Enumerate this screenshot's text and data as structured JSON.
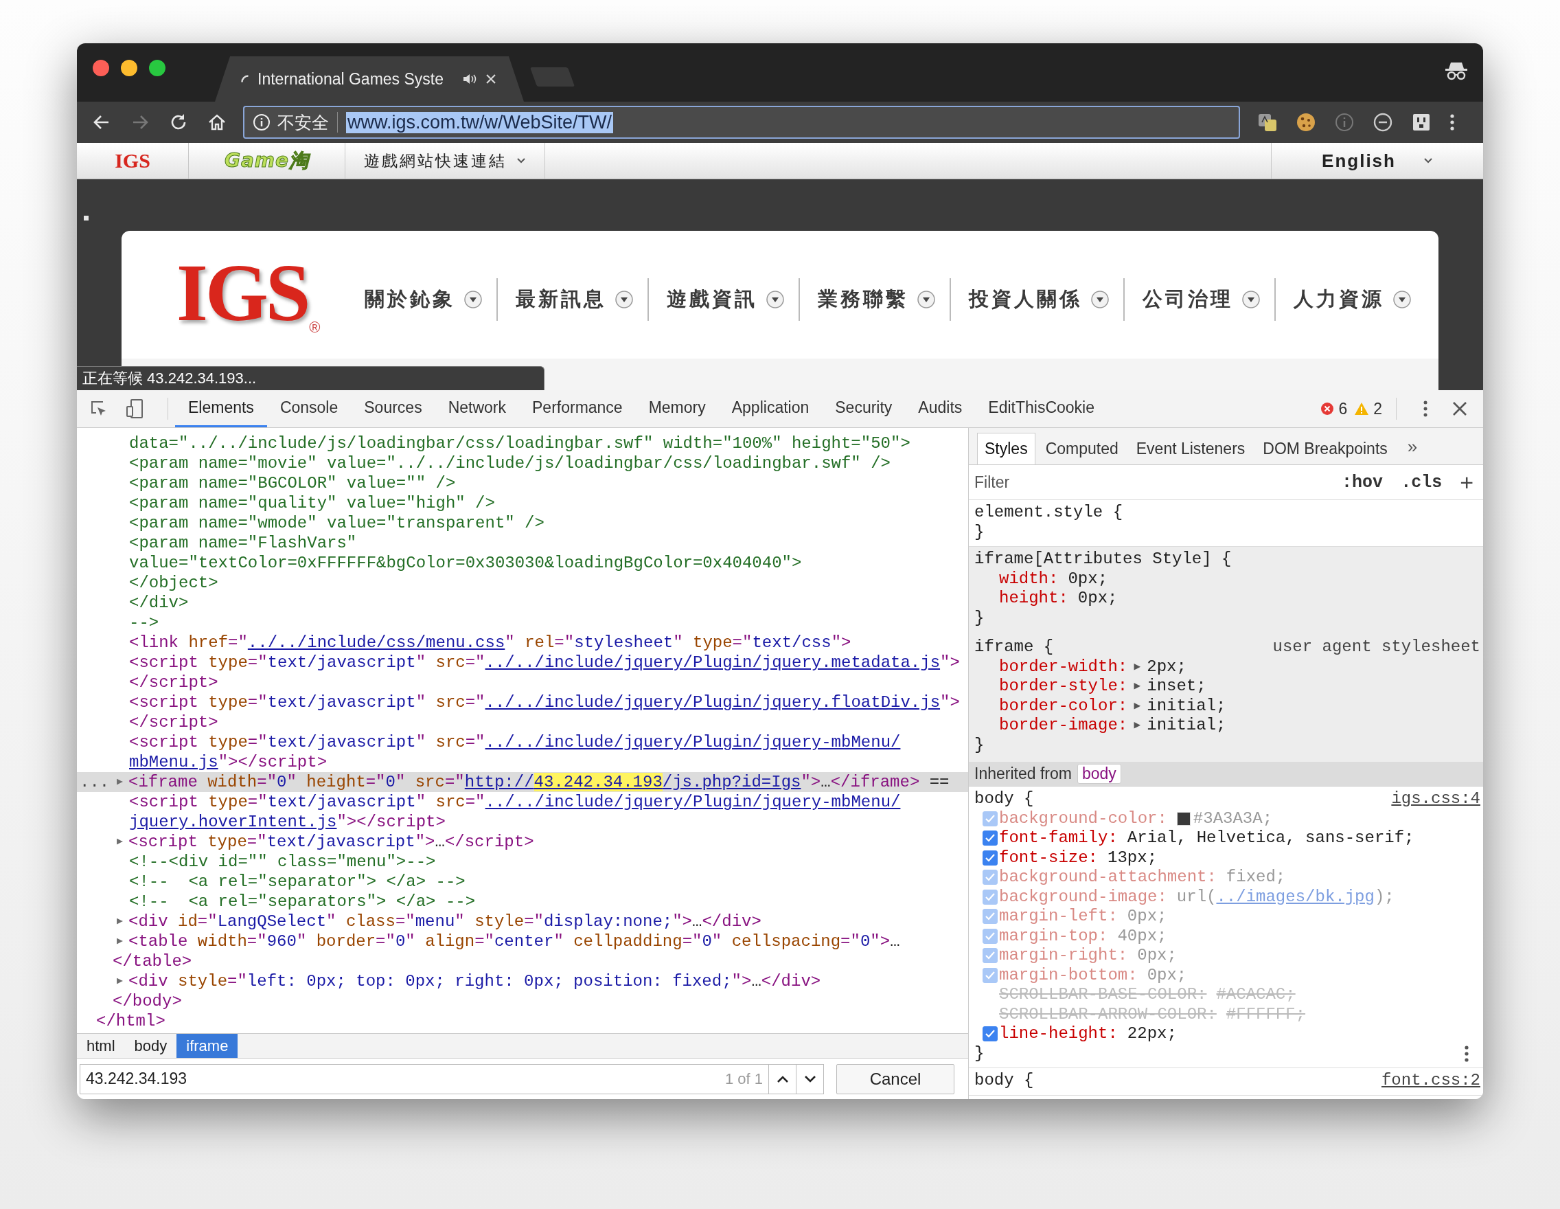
{
  "browser": {
    "tab": {
      "title": "International Games Syste"
    },
    "address": {
      "security": "不安全",
      "url": "www.igs.com.tw/w/WebSite/TW/",
      "selected": true
    }
  },
  "site_bar": {
    "logo": "IGS",
    "game_logo": "Game淘",
    "quick_links": "遊戲網站快速連結",
    "language": "English"
  },
  "site_header": {
    "logo": "IGS",
    "logo_mark": "®",
    "nav": [
      {
        "label": "關於鈊象"
      },
      {
        "label": "最新訊息"
      },
      {
        "label": "遊戲資訊"
      },
      {
        "label": "業務聯繫"
      },
      {
        "label": "投資人關係"
      },
      {
        "label": "公司治理"
      },
      {
        "label": "人力資源"
      }
    ]
  },
  "status_bubble": "正在等候 43.242.34.193...",
  "devtools": {
    "tabs": [
      {
        "label": "Elements",
        "selected": true
      },
      {
        "label": "Console",
        "selected": false
      },
      {
        "label": "Sources",
        "selected": false
      },
      {
        "label": "Network",
        "selected": false
      },
      {
        "label": "Performance",
        "selected": false
      },
      {
        "label": "Memory",
        "selected": false
      },
      {
        "label": "Application",
        "selected": false
      },
      {
        "label": "Security",
        "selected": false
      },
      {
        "label": "Audits",
        "selected": false
      },
      {
        "label": "EditThisCookie",
        "selected": false
      }
    ],
    "errors": "6",
    "warnings": "2",
    "dom_tree": [
      {
        "kind": "group",
        "children": [
          {
            "kind": "group",
            "children": [
              {
                "kind": "node",
                "selected": false,
                "tokens": [
                  {
                    "kind": "comment",
                    "text": "data=\"../../include/js/loadingbar/css/loadingbar.swf\" width=\"100%\" height=\"50\">"
                  }
                ]
              },
              {
                "kind": "node",
                "selected": false,
                "tokens": [
                  {
                    "kind": "comment",
                    "text": "<param name=\"movie\" value=\"../../include/js/loadingbar/css/loadingbar.swf\" />"
                  }
                ]
              },
              {
                "kind": "node",
                "selected": false,
                "tokens": [
                  {
                    "kind": "comment",
                    "text": "<param name=\"BGCOLOR\" value=\"\" />"
                  }
                ]
              },
              {
                "kind": "node",
                "selected": false,
                "tokens": [
                  {
                    "kind": "comment",
                    "text": "<param name=\"quality\" value=\"high\" />"
                  }
                ]
              },
              {
                "kind": "node",
                "selected": false,
                "tokens": [
                  {
                    "kind": "comment",
                    "text": "<param name=\"wmode\" value=\"transparent\" />"
                  }
                ]
              },
              {
                "kind": "node",
                "selected": false,
                "tokens": [
                  {
                    "kind": "comment",
                    "text": "<param name=\"FlashVars\""
                  }
                ]
              },
              {
                "kind": "node",
                "selected": false,
                "tokens": [
                  {
                    "kind": "comment",
                    "text": "value=\"textColor=0xFFFFFF&bgColor=0x303030&loadingBgColor=0x404040\">"
                  }
                ]
              },
              {
                "kind": "node",
                "selected": false,
                "tokens": [
                  {
                    "kind": "comment",
                    "text": "</object>"
                  }
                ]
              },
              {
                "kind": "node",
                "selected": false,
                "tokens": [
                  {
                    "kind": "comment",
                    "text": "</div>"
                  }
                ]
              },
              {
                "kind": "node",
                "selected": false,
                "tokens": [
                  {
                    "kind": "comment",
                    "text": "-->"
                  }
                ]
              },
              {
                "kind": "node",
                "selected": false,
                "tokens": [
                  {
                    "kind": "tag",
                    "text": "<link "
                  },
                  {
                    "kind": "attr",
                    "text": "href"
                  },
                  {
                    "kind": "tag",
                    "text": "=\""
                  },
                  {
                    "kind": "link",
                    "text": "../../include/css/menu.css"
                  },
                  {
                    "kind": "tag",
                    "text": "\" "
                  },
                  {
                    "kind": "attr",
                    "text": "rel"
                  },
                  {
                    "kind": "tag",
                    "text": "=\""
                  },
                  {
                    "kind": "value",
                    "text": "stylesheet"
                  },
                  {
                    "kind": "tag",
                    "text": "\" "
                  },
                  {
                    "kind": "attr",
                    "text": "type"
                  },
                  {
                    "kind": "tag",
                    "text": "=\""
                  },
                  {
                    "kind": "value",
                    "text": "text/css"
                  },
                  {
                    "kind": "tag",
                    "text": "\">"
                  }
                ]
              },
              {
                "kind": "node",
                "selected": false,
                "tokens": [
                  {
                    "kind": "tag",
                    "text": "<script "
                  },
                  {
                    "kind": "attr",
                    "text": "type"
                  },
                  {
                    "kind": "tag",
                    "text": "=\""
                  },
                  {
                    "kind": "value",
                    "text": "text/javascript"
                  },
                  {
                    "kind": "tag",
                    "text": "\" "
                  },
                  {
                    "kind": "attr",
                    "text": "src"
                  },
                  {
                    "kind": "tag",
                    "text": "=\""
                  },
                  {
                    "kind": "link",
                    "text": "../../include/jquery/Plugin/jquery.metadata.js"
                  },
                  {
                    "kind": "tag",
                    "text": "\">"
                  }
                ]
              },
              {
                "kind": "node",
                "selected": false,
                "tokens": [
                  {
                    "kind": "tag",
                    "text": "</script>"
                  }
                ]
              },
              {
                "kind": "node",
                "selected": false,
                "tokens": [
                  {
                    "kind": "tag",
                    "text": "<script "
                  },
                  {
                    "kind": "attr",
                    "text": "type"
                  },
                  {
                    "kind": "tag",
                    "text": "=\""
                  },
                  {
                    "kind": "value",
                    "text": "text/javascript"
                  },
                  {
                    "kind": "tag",
                    "text": "\" "
                  },
                  {
                    "kind": "attr",
                    "text": "src"
                  },
                  {
                    "kind": "tag",
                    "text": "=\""
                  },
                  {
                    "kind": "link",
                    "text": "../../include/jquery/Plugin/jquery.floatDiv.js"
                  },
                  {
                    "kind": "tag",
                    "text": "\">"
                  }
                ]
              },
              {
                "kind": "node",
                "selected": false,
                "tokens": [
                  {
                    "kind": "tag",
                    "text": "</script>"
                  }
                ]
              },
              {
                "kind": "node",
                "selected": false,
                "tokens": [
                  {
                    "kind": "tag",
                    "text": "<script "
                  },
                  {
                    "kind": "attr",
                    "text": "type"
                  },
                  {
                    "kind": "tag",
                    "text": "=\""
                  },
                  {
                    "kind": "value",
                    "text": "text/javascript"
                  },
                  {
                    "kind": "tag",
                    "text": "\" "
                  },
                  {
                    "kind": "attr",
                    "text": "src"
                  },
                  {
                    "kind": "tag",
                    "text": "=\""
                  },
                  {
                    "kind": "link",
                    "text": "../../include/jquery/Plugin/jquery-mbMenu/"
                  }
                ]
              },
              {
                "kind": "node",
                "selected": false,
                "tokens": [
                  {
                    "kind": "link",
                    "text": "mbMenu.js"
                  },
                  {
                    "kind": "tag",
                    "text": "\"></script>"
                  }
                ]
              },
              {
                "kind": "node",
                "selected": true,
                "gutter": "...",
                "tokens": [
                  {
                    "kind": "toggle",
                    "text": "▶"
                  },
                  {
                    "kind": "tag",
                    "text": "<iframe "
                  },
                  {
                    "kind": "attr",
                    "text": "width"
                  },
                  {
                    "kind": "tag",
                    "text": "=\""
                  },
                  {
                    "kind": "value",
                    "text": "0"
                  },
                  {
                    "kind": "tag",
                    "text": "\" "
                  },
                  {
                    "kind": "attr",
                    "text": "height"
                  },
                  {
                    "kind": "tag",
                    "text": "=\""
                  },
                  {
                    "kind": "value",
                    "text": "0"
                  },
                  {
                    "kind": "tag",
                    "text": "\" "
                  },
                  {
                    "kind": "attr",
                    "text": "src"
                  },
                  {
                    "kind": "tag",
                    "text": "=\""
                  },
                  {
                    "kind": "link",
                    "text": "http://"
                  },
                  {
                    "kind": "match",
                    "text": "43.242.34.193"
                  },
                  {
                    "kind": "link",
                    "text": "/js.php?id=Igs"
                  },
                  {
                    "kind": "tag",
                    "text": "\">"
                  },
                  {
                    "kind": "plain",
                    "text": "…"
                  },
                  {
                    "kind": "tag",
                    "text": "</iframe>"
                  },
                  {
                    "kind": "plain",
                    "text": " =="
                  }
                ]
              },
              {
                "kind": "node",
                "selected": false,
                "tokens": [
                  {
                    "kind": "tag",
                    "text": "<script "
                  },
                  {
                    "kind": "attr",
                    "text": "type"
                  },
                  {
                    "kind": "tag",
                    "text": "=\""
                  },
                  {
                    "kind": "value",
                    "text": "text/javascript"
                  },
                  {
                    "kind": "tag",
                    "text": "\" "
                  },
                  {
                    "kind": "attr",
                    "text": "src"
                  },
                  {
                    "kind": "tag",
                    "text": "=\""
                  },
                  {
                    "kind": "link",
                    "text": "../../include/jquery/Plugin/jquery-mbMenu/"
                  }
                ]
              },
              {
                "kind": "node",
                "selected": false,
                "tokens": [
                  {
                    "kind": "link",
                    "text": "jquery.hoverIntent.js"
                  },
                  {
                    "kind": "tag",
                    "text": "\"></script>"
                  }
                ]
              },
              {
                "kind": "node",
                "selected": false,
                "tokens": [
                  {
                    "kind": "toggle",
                    "text": "▶"
                  },
                  {
                    "kind": "tag",
                    "text": "<script "
                  },
                  {
                    "kind": "attr",
                    "text": "type"
                  },
                  {
                    "kind": "tag",
                    "text": "=\""
                  },
                  {
                    "kind": "value",
                    "text": "text/javascript"
                  },
                  {
                    "kind": "tag",
                    "text": "\">"
                  },
                  {
                    "kind": "plain",
                    "text": "…"
                  },
                  {
                    "kind": "tag",
                    "text": "</script>"
                  }
                ]
              },
              {
                "kind": "node",
                "selected": false,
                "tokens": [
                  {
                    "kind": "comment",
                    "text": "<!--<div id=\"\" class=\"menu\">-->"
                  }
                ]
              },
              {
                "kind": "node",
                "selected": false,
                "tokens": [
                  {
                    "kind": "comment",
                    "text": "<!--  <a rel=\"separator\"> </a> -->"
                  }
                ]
              },
              {
                "kind": "node",
                "selected": false,
                "tokens": [
                  {
                    "kind": "comment",
                    "text": "<!--  <a rel=\"separators\"> </a> -->"
                  }
                ]
              },
              {
                "kind": "node",
                "selected": false,
                "tokens": [
                  {
                    "kind": "toggle",
                    "text": "▶"
                  },
                  {
                    "kind": "tag",
                    "text": "<div "
                  },
                  {
                    "kind": "attr",
                    "text": "id"
                  },
                  {
                    "kind": "tag",
                    "text": "=\""
                  },
                  {
                    "kind": "value",
                    "text": "LangQSelect"
                  },
                  {
                    "kind": "tag",
                    "text": "\" "
                  },
                  {
                    "kind": "attr",
                    "text": "class"
                  },
                  {
                    "kind": "tag",
                    "text": "=\""
                  },
                  {
                    "kind": "value",
                    "text": "menu"
                  },
                  {
                    "kind": "tag",
                    "text": "\" "
                  },
                  {
                    "kind": "attr",
                    "text": "style"
                  },
                  {
                    "kind": "tag",
                    "text": "=\""
                  },
                  {
                    "kind": "value",
                    "text": "display:none;"
                  },
                  {
                    "kind": "tag",
                    "text": "\">"
                  },
                  {
                    "kind": "plain",
                    "text": "…"
                  },
                  {
                    "kind": "tag",
                    "text": "</div>"
                  }
                ]
              },
              {
                "kind": "node",
                "selected": false,
                "tokens": [
                  {
                    "kind": "toggle",
                    "text": "▶"
                  },
                  {
                    "kind": "tag",
                    "text": "<table "
                  },
                  {
                    "kind": "attr",
                    "text": "width"
                  },
                  {
                    "kind": "tag",
                    "text": "=\""
                  },
                  {
                    "kind": "value",
                    "text": "960"
                  },
                  {
                    "kind": "tag",
                    "text": "\" "
                  },
                  {
                    "kind": "attr",
                    "text": "border"
                  },
                  {
                    "kind": "tag",
                    "text": "=\""
                  },
                  {
                    "kind": "value",
                    "text": "0"
                  },
                  {
                    "kind": "tag",
                    "text": "\" "
                  },
                  {
                    "kind": "attr",
                    "text": "align"
                  },
                  {
                    "kind": "tag",
                    "text": "=\""
                  },
                  {
                    "kind": "value",
                    "text": "center"
                  },
                  {
                    "kind": "tag",
                    "text": "\" "
                  },
                  {
                    "kind": "attr",
                    "text": "cellpadding"
                  },
                  {
                    "kind": "tag",
                    "text": "=\""
                  },
                  {
                    "kind": "value",
                    "text": "0"
                  },
                  {
                    "kind": "tag",
                    "text": "\" "
                  },
                  {
                    "kind": "attr",
                    "text": "cellspacing"
                  },
                  {
                    "kind": "tag",
                    "text": "=\""
                  },
                  {
                    "kind": "value",
                    "text": "0"
                  },
                  {
                    "kind": "tag",
                    "text": "\">"
                  },
                  {
                    "kind": "plain",
                    "text": "…"
                  }
                ]
              },
              {
                "kind": "tail",
                "selected": false,
                "tokens": [
                  {
                    "kind": "tag",
                    "text": "</table>"
                  }
                ]
              },
              {
                "kind": "node",
                "selected": false,
                "tokens": [
                  {
                    "kind": "toggle",
                    "text": "▶"
                  },
                  {
                    "kind": "tag",
                    "text": "<div "
                  },
                  {
                    "kind": "attr",
                    "text": "style"
                  },
                  {
                    "kind": "tag",
                    "text": "=\""
                  },
                  {
                    "kind": "value",
                    "text": "left: 0px; top: 0px; right: 0px; position: fixed;"
                  },
                  {
                    "kind": "tag",
                    "text": "\">"
                  },
                  {
                    "kind": "plain",
                    "text": "…"
                  },
                  {
                    "kind": "tag",
                    "text": "</div>"
                  }
                ]
              }
            ]
          },
          {
            "kind": "node",
            "selected": false,
            "tokens": [
              {
                "kind": "tag",
                "text": "</body>"
              }
            ]
          }
        ]
      },
      {
        "kind": "node",
        "selected": false,
        "tokens": [
          {
            "kind": "tag",
            "text": "</html>"
          }
        ]
      }
    ],
    "breadcrumbs": [
      {
        "label": "html",
        "selected": false
      },
      {
        "label": "body",
        "selected": false
      },
      {
        "label": "iframe",
        "selected": true
      }
    ],
    "search": {
      "value": "43.242.34.193",
      "count": "1 of 1",
      "cancel": "Cancel"
    },
    "sidebar": {
      "tabs": [
        {
          "label": "Styles",
          "selected": true
        },
        {
          "label": "Computed",
          "selected": false
        },
        {
          "label": "Event Listeners",
          "selected": false
        },
        {
          "label": "DOM Breakpoints",
          "selected": false
        }
      ],
      "more": "»",
      "filter": {
        "placeholder": "Filter"
      },
      "buttons": [
        ":hov",
        ".cls",
        "+"
      ],
      "rules": [
        {
          "kind": "editable",
          "selector": "element.style {",
          "close": "}"
        },
        {
          "kind": "readonly",
          "selector": "iframe[Attributes Style] {",
          "props": [
            {
              "kind": "plain",
              "name": "width:",
              "value": "0px;"
            },
            {
              "kind": "plain",
              "name": "height:",
              "value": "0px;"
            }
          ],
          "close": "}"
        },
        {
          "kind": "readonly",
          "selector": "iframe {",
          "source": "user agent stylesheet",
          "props": [
            {
              "kind": "expand",
              "name": "border-width:",
              "toggle": "▶",
              "value": "2px;"
            },
            {
              "kind": "expand",
              "name": "border-style:",
              "toggle": "▶",
              "value": "inset;"
            },
            {
              "kind": "expand",
              "name": "border-color:",
              "toggle": "▶",
              "value": "initial;"
            },
            {
              "kind": "expand",
              "name": "border-image:",
              "toggle": "▶",
              "value": "initial;"
            }
          ],
          "close": "}"
        },
        {
          "kind": "inherited",
          "label": "Inherited from",
          "element": "body"
        },
        {
          "kind": "editable",
          "selector": "body {",
          "source": "igs.css:4",
          "props": [
            {
              "kind": "check",
              "checked": true,
              "dimmed": true,
              "name": "background-color:",
              "color": "#3a3a3a",
              "value": "#3A3A3A;"
            },
            {
              "kind": "check",
              "checked": true,
              "dimmed": false,
              "name": "font-family:",
              "value": "Arial, Helvetica, sans-serif;"
            },
            {
              "kind": "check",
              "checked": true,
              "dimmed": false,
              "name": "font-size:",
              "value": "13px;"
            },
            {
              "kind": "check",
              "checked": true,
              "dimmed": true,
              "name": "background-attachment:",
              "value": "fixed;"
            },
            {
              "kind": "check",
              "checked": true,
              "dimmed": true,
              "name": "background-image:",
              "value": "url(",
              "link": "../images/bk.jpg",
              "after": ");"
            },
            {
              "kind": "check",
              "checked": true,
              "dimmed": true,
              "name": "margin-left:",
              "value": "0px;"
            },
            {
              "kind": "check",
              "checked": true,
              "dimmed": true,
              "name": "margin-top:",
              "value": "40px;"
            },
            {
              "kind": "check",
              "checked": true,
              "dimmed": true,
              "name": "margin-right:",
              "value": "0px;"
            },
            {
              "kind": "check",
              "checked": true,
              "dimmed": true,
              "name": "margin-bottom:",
              "value": "0px;"
            },
            {
              "kind": "struck",
              "name": "SCROLLBAR-BASE-COLOR:",
              "value": "#ACACAC;"
            },
            {
              "kind": "struck",
              "name": "SCROLLBAR-ARROW-COLOR:",
              "value": "#FFFFFF;"
            },
            {
              "kind": "check",
              "checked": true,
              "dimmed": false,
              "name": "line-height:",
              "value": "22px;"
            }
          ],
          "close": "}"
        },
        {
          "kind": "editable",
          "selector": "body {",
          "source": "font.css:2"
        }
      ]
    }
  }
}
